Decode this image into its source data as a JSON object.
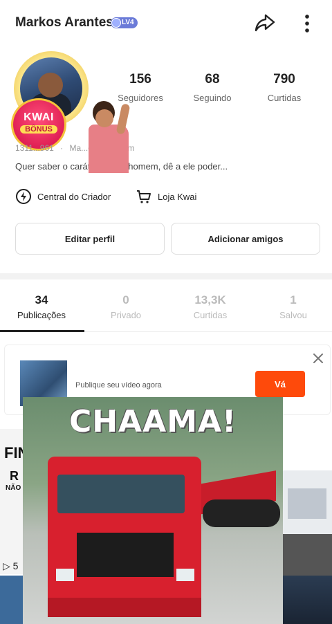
{
  "header": {
    "username": "Markos Arantes",
    "level_badge": "LV4",
    "share_icon": "share-arrow-icon",
    "more_icon": "more-vertical-icon"
  },
  "profile": {
    "avatar_badge_line1": "KWAI",
    "avatar_badge_line2": "BÔNUS",
    "meta": [
      "1311...961",
      "Ma...o",
      "Virgem"
    ],
    "bio": "Quer saber o caráter de um homem, dê a ele poder..."
  },
  "stats": [
    {
      "value": "156",
      "label": "Seguidores"
    },
    {
      "value": "68",
      "label": "Seguindo"
    },
    {
      "value": "790",
      "label": "Curtidas"
    }
  ],
  "links": [
    {
      "label": "Central do Criador",
      "icon": "lightning-icon"
    },
    {
      "label": "Loja Kwai",
      "icon": "cart-icon"
    }
  ],
  "buttons": {
    "edit_profile": "Editar perfil",
    "add_friends": "Adicionar amigos"
  },
  "tabs": [
    {
      "value": "34",
      "label": "Publicações",
      "active": true
    },
    {
      "value": "0",
      "label": "Privado",
      "active": false
    },
    {
      "value": "13,3K",
      "label": "Curtidas",
      "active": false
    },
    {
      "value": "1",
      "label": "Salvou",
      "active": false
    }
  ],
  "promo": {
    "text": "Publique seu vídeo agora",
    "button": "Vá",
    "close_icon": "close-icon"
  },
  "grid": {
    "left_text_1": "FIN",
    "left_text_2": "R",
    "left_text_3": "NÃO",
    "left_play": "▷ 5"
  },
  "sticker": {
    "caption": "CHAAMA!"
  },
  "colors": {
    "accent": "#fe4a0b",
    "level_badge": "#6b7bd8",
    "text_primary": "#222222",
    "text_secondary": "#999999"
  }
}
